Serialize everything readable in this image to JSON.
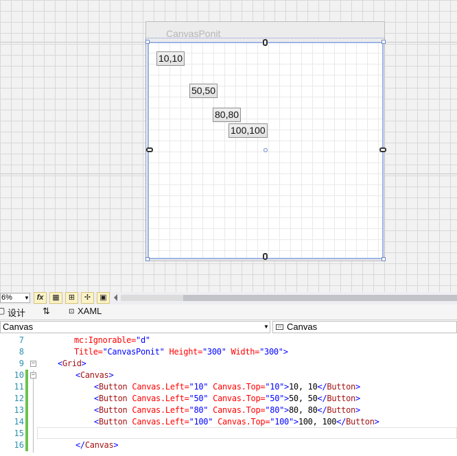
{
  "designer": {
    "window_title": "CanvasPonit",
    "buttons": [
      {
        "label": "10,10"
      },
      {
        "label": "50,50"
      },
      {
        "label": "80,80"
      },
      {
        "label": "100,100"
      }
    ]
  },
  "toolbar": {
    "zoom": "6%",
    "fx_label": "fx"
  },
  "tabs": {
    "design": "设计",
    "swap": "⇅",
    "xaml": "XAML"
  },
  "navbar": {
    "left": "Canvas",
    "right": "Canvas"
  },
  "editor": {
    "lines": [
      {
        "num": "7"
      },
      {
        "num": "8"
      },
      {
        "num": "9"
      },
      {
        "num": "10"
      },
      {
        "num": "11"
      },
      {
        "num": "12"
      },
      {
        "num": "13"
      },
      {
        "num": "14"
      },
      {
        "num": "15"
      },
      {
        "num": "16"
      }
    ],
    "tokens": {
      "l7_attr": "mc:Ignorable=",
      "l7_val": "\"d\"",
      "l8_a1": "Title=",
      "l8_v1": "\"CanvasPonit\"",
      "l8_a2": " Height=",
      "l8_v2": "\"300\"",
      "l8_a3": " Width=",
      "l8_v3": "\"300\"",
      "l8_end": ">",
      "l9_open": "<",
      "l9_tag": "Grid",
      "l9_close": ">",
      "l10_open": "<",
      "l10_tag": "Canvas",
      "l10_close": ">",
      "btn_open": "<",
      "btn_tag": "Button",
      "attr_left": " Canvas.Left=",
      "attr_top": " Canvas.Top=",
      "gt": ">",
      "close_open": "</",
      "close_gt": ">",
      "l11_left": "\"10\"",
      "l11_top": "\"10\"",
      "l11_text": "10, 10",
      "l12_left": "\"50\"",
      "l12_top": "\"50\"",
      "l12_text": "50, 50",
      "l13_left": "\"80\"",
      "l13_top": "\"80\"",
      "l13_text": "80, 80",
      "l14_left": "\"100\"",
      "l14_top": "\"100\"",
      "l14_text": "100, 100",
      "l16_open": "</",
      "l16_tag": "Canvas",
      "l16_close": ">"
    }
  }
}
